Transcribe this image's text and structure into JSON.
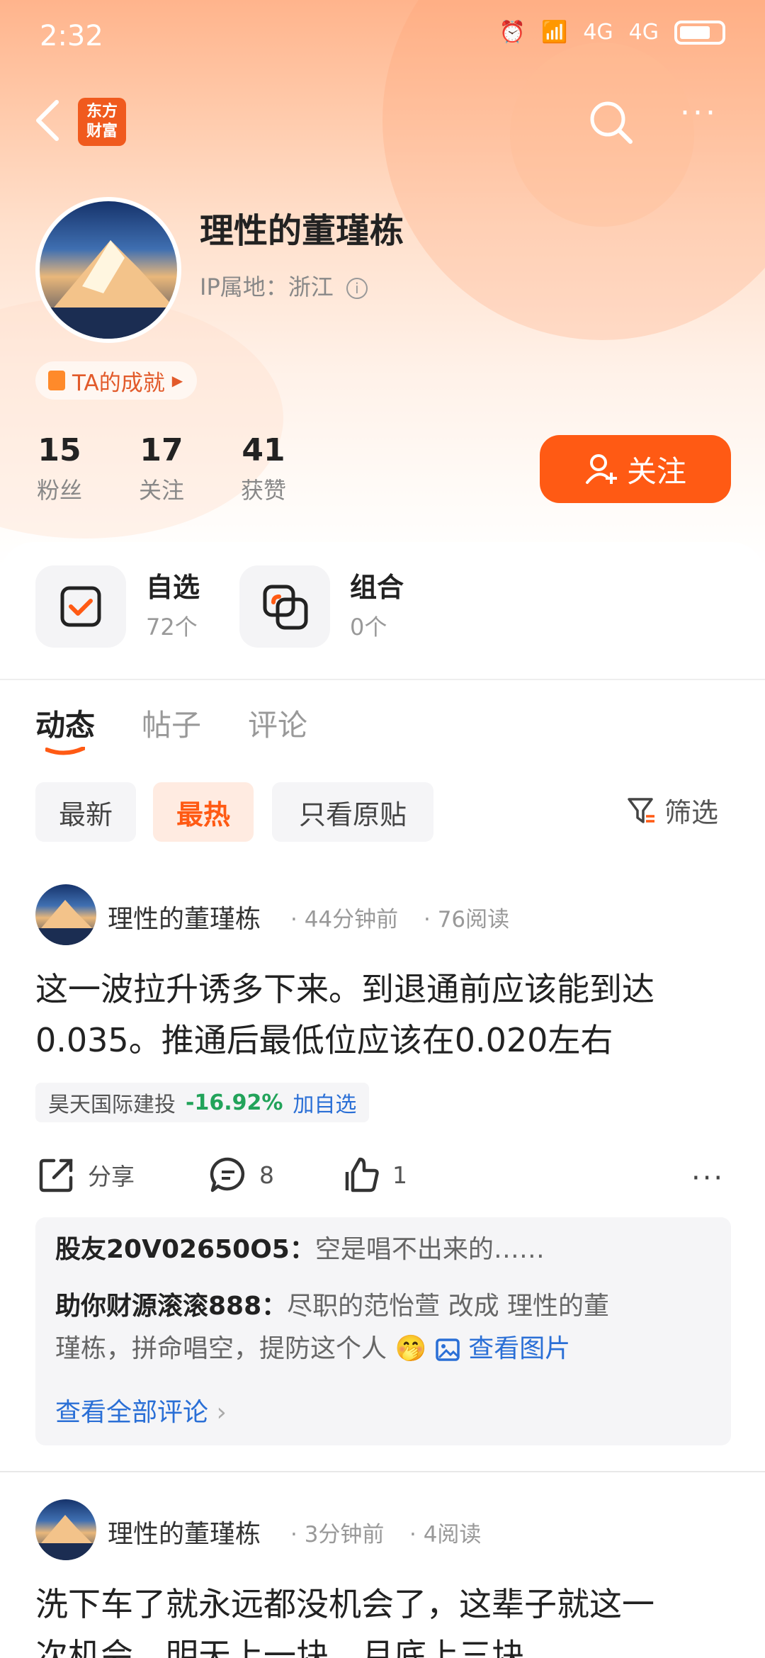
{
  "status_bar": {
    "time": "2:32",
    "net1": "4G",
    "net2": "4G"
  },
  "nav": {
    "logo_line1": "东方",
    "logo_line2": "财富"
  },
  "profile": {
    "name": "理性的董瑾栋",
    "ip_label": "IP属地：浙江",
    "achievement": "TA的成就",
    "stats": [
      {
        "num": "15",
        "label": "粉丝"
      },
      {
        "num": "17",
        "label": "关注"
      },
      {
        "num": "41",
        "label": "获赞"
      }
    ],
    "follow_label": "关注"
  },
  "tools": [
    {
      "title": "自选",
      "count": "72个"
    },
    {
      "title": "组合",
      "count": "0个"
    }
  ],
  "tabs": [
    "动态",
    "帖子",
    "评论"
  ],
  "filters": {
    "chips": [
      "最新",
      "最热",
      "只看原贴"
    ],
    "filter_label": "筛选"
  },
  "posts": [
    {
      "author": "理性的董瑾栋",
      "time": "· 44分钟前",
      "reads": "· 76阅读",
      "body_line1": "这一波拉升诱多下来。到退通前应该能到达",
      "body_line2": "0.035。推通后最低位应该在0.020左右",
      "stock": {
        "name": "昊天国际建投",
        "change": "-16.92%",
        "add": "加自选"
      },
      "actions": {
        "share": "分享",
        "comments": "8",
        "likes": "1"
      },
      "comment_list": [
        {
          "user": "股友20V02650O5：",
          "text": "空是唱不出来的……"
        },
        {
          "user": "助你财源滚滚888：",
          "text": "尽职的范怡萱 改成 理性的董",
          "text2": "瑾栋，拼命唱空，提防这个人",
          "emoji": "🤭",
          "img_link": "查看图片"
        }
      ],
      "view_all": "查看全部评论"
    },
    {
      "author": "理性的董瑾栋",
      "time": "· 3分钟前",
      "reads": "· 4阅读",
      "body_line1": "洗下车了就永远都没机会了，这辈子就这一",
      "body_line2": "次机会，明天上一块，月底上三块"
    }
  ],
  "colors": {
    "accent": "#ff5a14",
    "gain_loss": "#22a35a",
    "link": "#2a6fd6"
  }
}
